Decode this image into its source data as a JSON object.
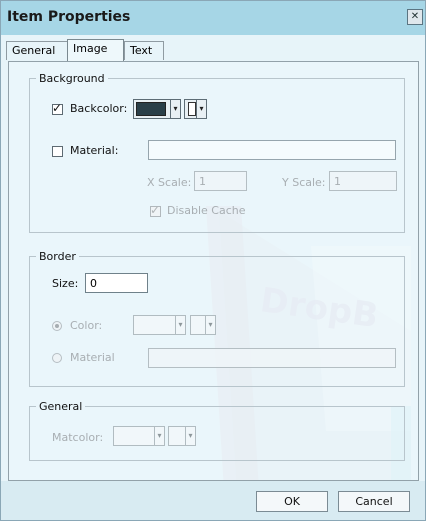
{
  "dialog": {
    "title": "Item Properties",
    "close_icon": "close-icon"
  },
  "tabs": [
    {
      "label": "General",
      "active": false
    },
    {
      "label": "Image",
      "active": true
    },
    {
      "label": "Text",
      "active": false
    }
  ],
  "background": {
    "legend": "Background",
    "backcolor_label": "Backcolor:",
    "backcolor_checked": true,
    "backcolor_swatch": "#2a3f48",
    "pattern_swatch": "#ffffff",
    "material_label": "Material:",
    "material_checked": false,
    "material_value": "",
    "xscale_label": "X Scale:",
    "xscale_value": "1",
    "yscale_label": "Y Scale:",
    "yscale_value": "1",
    "disable_cache_label": "Disable Cache",
    "disable_cache_checked": true
  },
  "border": {
    "legend": "Border",
    "size_label": "Size:",
    "size_value": "0",
    "color_label": "Color:",
    "color_selected": true,
    "material_label": "Material",
    "material_selected": false,
    "material_value": ""
  },
  "general": {
    "legend": "General",
    "matcolor_label": "Matcolor:"
  },
  "buttons": {
    "ok": "OK",
    "cancel": "Cancel"
  },
  "colors": {
    "accent": "#a6d6e6",
    "background": "#e7f4f9"
  }
}
